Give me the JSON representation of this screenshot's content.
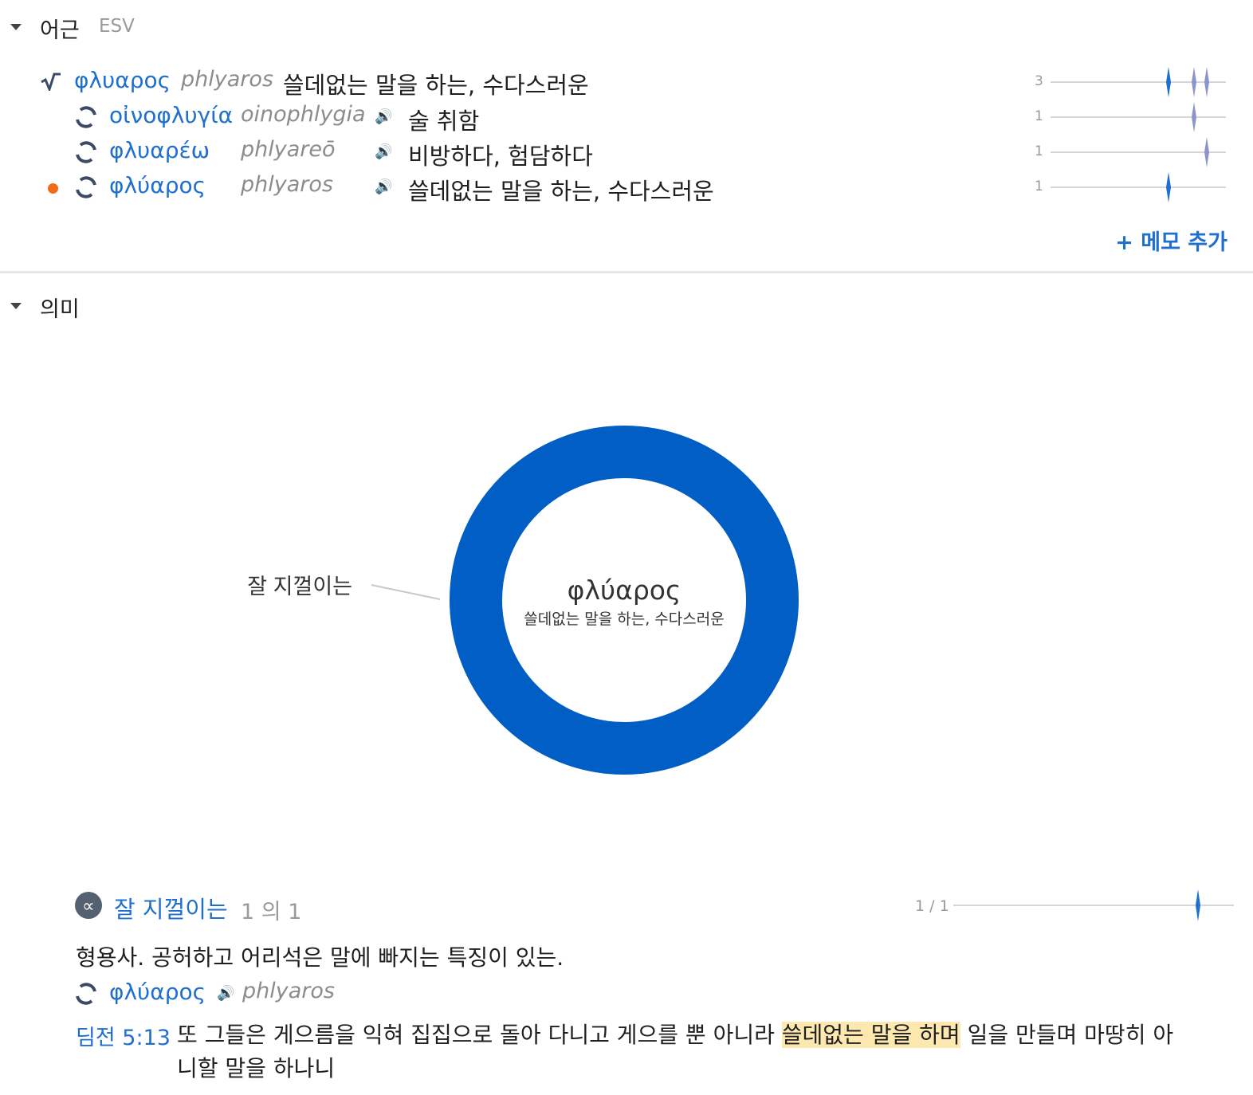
{
  "colors": {
    "accent": "#1f6fd1",
    "donut": "#005ec4",
    "spark_light": "#8b95c9",
    "dot": "#f26b16",
    "highlight": "#fde9b0"
  },
  "roots": {
    "title": "어근",
    "version": "ESV",
    "items": [
      {
        "icon": "root-icon",
        "greek": "φλυαρος",
        "translit": "phlyaros",
        "gloss": "쓸데없는 말을 하는, 수다스러운",
        "count": "3"
      },
      {
        "icon": "cycle-icon",
        "greek": "οἰνοφλυγία",
        "translit": "oinophlygia",
        "gloss": "술 취함",
        "count": "1"
      },
      {
        "icon": "cycle-icon",
        "greek": "φλυαρέω",
        "translit": "phlyareō",
        "gloss": "비방하다, 험담하다",
        "count": "1"
      },
      {
        "icon": "cycle-icon",
        "greek": "φλύαρος",
        "translit": "phlyaros",
        "gloss": "쓸데없는 말을 하는, 수다스러운",
        "count": "1",
        "current": true
      }
    ],
    "add_memo": "+ 메모 추가"
  },
  "senses": {
    "title": "의미",
    "chart_data": {
      "type": "pie",
      "center_title": "φλύαρος",
      "center_subtitle": "쓸데없는 말을 하는, 수다스러운",
      "categories": [
        "잘 지껄이는"
      ],
      "values": [
        1
      ]
    },
    "detail": {
      "title": "잘 지껄이는",
      "count_text": "1 의 1",
      "pager": "1 / 1",
      "definition": "형용사. 공허하고 어리석은 말에 빠지는 특징이 있는.",
      "word_greek": "φλύαρος",
      "word_translit": "phlyaros",
      "verse_ref": "딤전 5:13",
      "verse_pre": "또 그들은 게으름을 익혀 집집으로 돌아 다니고 게으를 뿐 아니라 ",
      "verse_highlight": "쓸데없는 말을 하며",
      "verse_post_1": " 일을 만들며 마땅히 아",
      "verse_post_2": "니할 말을 하나니"
    }
  }
}
